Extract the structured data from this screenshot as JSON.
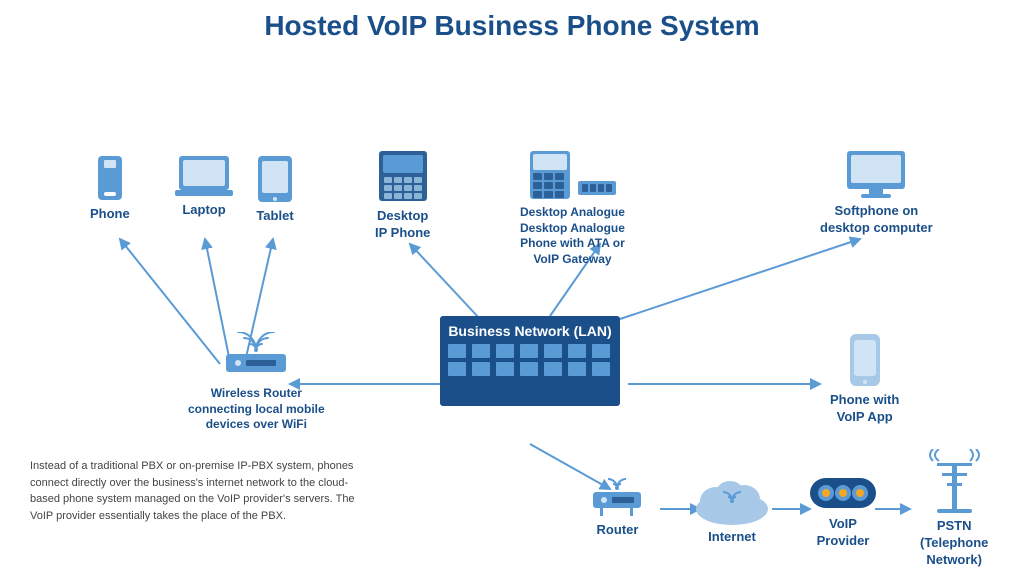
{
  "title": "Hosted VoIP Business Phone System",
  "devices": {
    "phone": {
      "label": "Phone"
    },
    "laptop": {
      "label": "Laptop"
    },
    "tablet": {
      "label": "Tablet"
    },
    "desktop_ip_phone": {
      "label": "Desktop\nIP Phone"
    },
    "analogue_phone": {
      "label": "Desktop Analogue\nPhone with ATA or\nVoIP Gateway"
    },
    "softphone": {
      "label": "Softphone on\ndesktop computer"
    },
    "wireless_router": {
      "label": "Wireless Router\nconnecting local mobile\ndevices over WiFi"
    },
    "business_network": {
      "label": "Business Network (LAN)"
    },
    "voip_phone": {
      "label": "Phone with\nVoIP App"
    },
    "router_bottom": {
      "label": "Router"
    },
    "internet": {
      "label": "Internet"
    },
    "voip_provider": {
      "label": "VoIP\nProvider"
    },
    "pstn": {
      "label": "PSTN\n(Telephone\nNetwork)"
    }
  },
  "info_text": "Instead of a traditional PBX or on-premise IP-PBX system, phones connect directly over the business's internet network to the cloud-based phone system managed on the VoIP provider's servers. The VoIP provider essentially takes the place of the PBX.",
  "colors": {
    "primary_blue": "#1a4f8a",
    "mid_blue": "#5b9bd5",
    "light_blue": "#a8c8e8",
    "very_light_blue": "#d0e4f5",
    "text_dark": "#333",
    "arrow_color": "#5b9bd5"
  }
}
